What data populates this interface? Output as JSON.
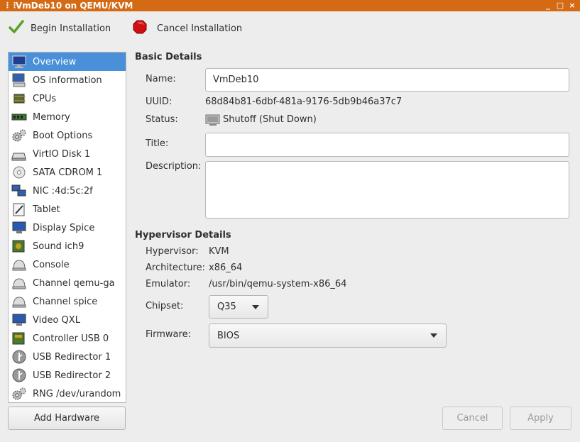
{
  "window": {
    "title": "VmDeb10 on QEMU/KVM",
    "controls": [
      "_",
      "□",
      "×"
    ]
  },
  "toolbar": {
    "begin_label": "Begin Installation",
    "cancel_label": "Cancel Installation"
  },
  "sidebar": {
    "items": [
      {
        "label": "Overview",
        "icon": "monitor-icon",
        "selected": true
      },
      {
        "label": "OS information",
        "icon": "computer-info-icon"
      },
      {
        "label": "CPUs",
        "icon": "cpu-icon"
      },
      {
        "label": "Memory",
        "icon": "memory-icon"
      },
      {
        "label": "Boot Options",
        "icon": "gears-icon"
      },
      {
        "label": "VirtIO Disk 1",
        "icon": "disk-icon"
      },
      {
        "label": "SATA CDROM 1",
        "icon": "cdrom-icon"
      },
      {
        "label": "NIC :4d:5c:2f",
        "icon": "network-icon"
      },
      {
        "label": "Tablet",
        "icon": "tablet-icon"
      },
      {
        "label": "Display Spice",
        "icon": "display-icon"
      },
      {
        "label": "Sound ich9",
        "icon": "sound-icon"
      },
      {
        "label": "Console",
        "icon": "console-icon"
      },
      {
        "label": "Channel qemu-ga",
        "icon": "channel-icon"
      },
      {
        "label": "Channel spice",
        "icon": "channel-icon"
      },
      {
        "label": "Video QXL",
        "icon": "video-icon"
      },
      {
        "label": "Controller USB 0",
        "icon": "controller-icon"
      },
      {
        "label": "USB Redirector 1",
        "icon": "usb-icon"
      },
      {
        "label": "USB Redirector 2",
        "icon": "usb-icon"
      },
      {
        "label": "RNG /dev/urandom",
        "icon": "gears-icon"
      }
    ],
    "add_hardware_label": "Add Hardware"
  },
  "basic": {
    "heading": "Basic Details",
    "name_label": "Name:",
    "name_value": "VmDeb10",
    "uuid_label": "UUID:",
    "uuid_value": "68d84b81-6dbf-481a-9176-5db9b46a37c7",
    "status_label": "Status:",
    "status_value": "Shutoff (Shut Down)",
    "title_label": "Title:",
    "title_value": "",
    "description_label": "Description:",
    "description_value": ""
  },
  "hypervisor": {
    "heading": "Hypervisor Details",
    "hypervisor_label": "Hypervisor:",
    "hypervisor_value": "KVM",
    "arch_label": "Architecture:",
    "arch_value": "x86_64",
    "emulator_label": "Emulator:",
    "emulator_value": "/usr/bin/qemu-system-x86_64",
    "chipset_label": "Chipset:",
    "chipset_value": "Q35",
    "firmware_label": "Firmware:",
    "firmware_value": "BIOS"
  },
  "actions": {
    "cancel_label": "Cancel",
    "apply_label": "Apply"
  }
}
